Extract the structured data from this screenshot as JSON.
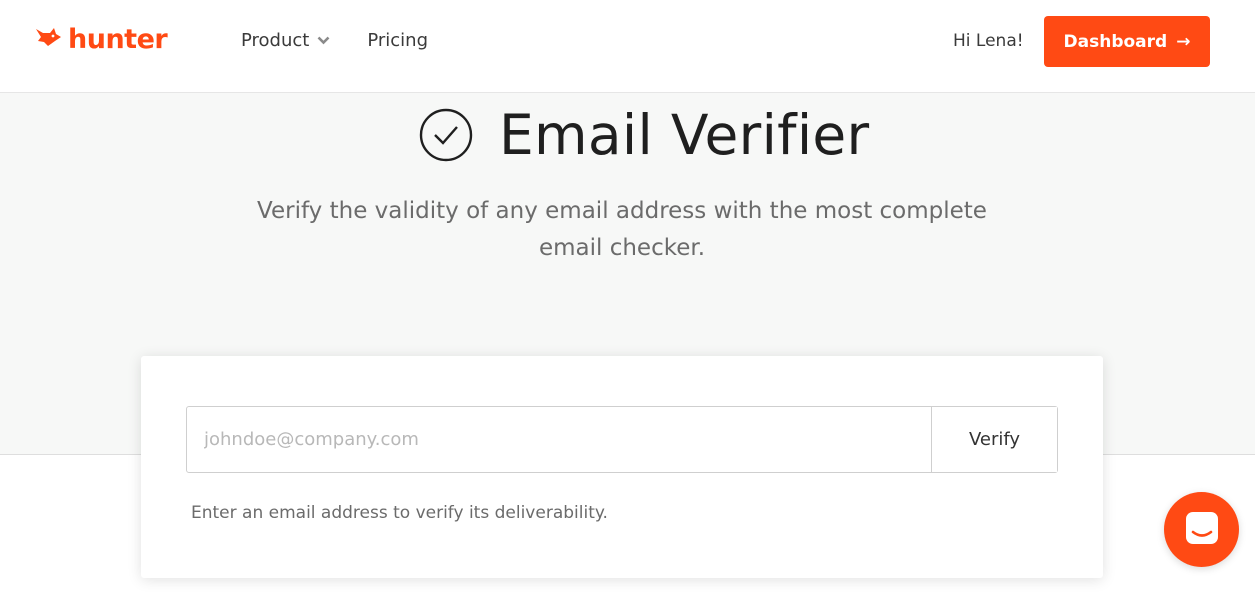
{
  "header": {
    "logo_text": "hunter",
    "nav": [
      {
        "label": "Product",
        "has_dropdown": true
      },
      {
        "label": "Pricing",
        "has_dropdown": false
      }
    ],
    "greeting": "Hi Lena!",
    "dashboard_label": "Dashboard",
    "dashboard_arrow": "→"
  },
  "hero": {
    "title": "Email Verifier",
    "subtitle": "Verify the validity of any email address with the most complete email checker.",
    "title_icon": "check-circle-icon"
  },
  "verifier": {
    "placeholder": "johndoe@company.com",
    "value": "",
    "button_label": "Verify",
    "helper_text": "Enter an email address to verify its deliverability."
  },
  "chat": {
    "icon": "chat-bubble-icon"
  },
  "colors": {
    "brand": "#ff4a14",
    "hero_bg": "#f7f8f7",
    "text_dark": "#1f1f1f",
    "text_muted": "#6b6b6b"
  }
}
